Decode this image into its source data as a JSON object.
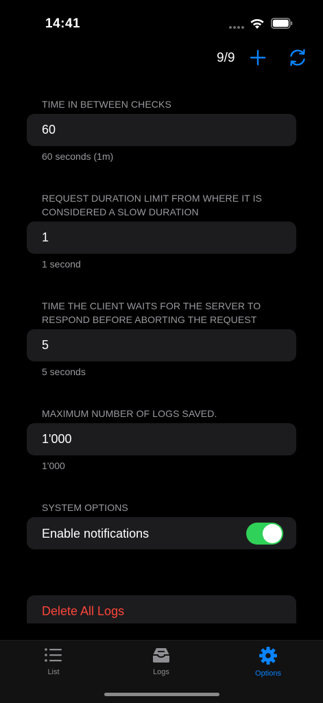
{
  "status_bar": {
    "time": "14:41"
  },
  "nav": {
    "counter": "9/9",
    "add_icon": "plus-icon",
    "refresh_icon": "refresh-icon"
  },
  "sections": {
    "check_interval": {
      "header": "Time in between checks",
      "value": "60",
      "footer": "60 seconds (1m)"
    },
    "slow_duration": {
      "header": "Request duration limit from where it is considered a slow duration",
      "value": "1",
      "footer": "1 second"
    },
    "timeout": {
      "header": "Time the client waits for the server to respond before aborting the request",
      "value": "5",
      "footer": "5 seconds"
    },
    "max_logs": {
      "header": "Maximum number of logs saved.",
      "value": "1'000",
      "footer": "1'000"
    },
    "system_options": {
      "header": "System options",
      "notifications_label": "Enable notifications",
      "notifications_enabled": true
    }
  },
  "delete_all_logs": "Delete All Logs",
  "tabs": [
    {
      "label": "List",
      "icon": "list-icon",
      "active": false
    },
    {
      "label": "Logs",
      "icon": "tray-icon",
      "active": false
    },
    {
      "label": "Options",
      "icon": "gear-icon",
      "active": true
    }
  ],
  "colors": {
    "accent": "#0a84ff",
    "destructive": "#ff453a",
    "toggle_on": "#30d158",
    "background": "#000000",
    "cell": "#1c1c1e"
  }
}
